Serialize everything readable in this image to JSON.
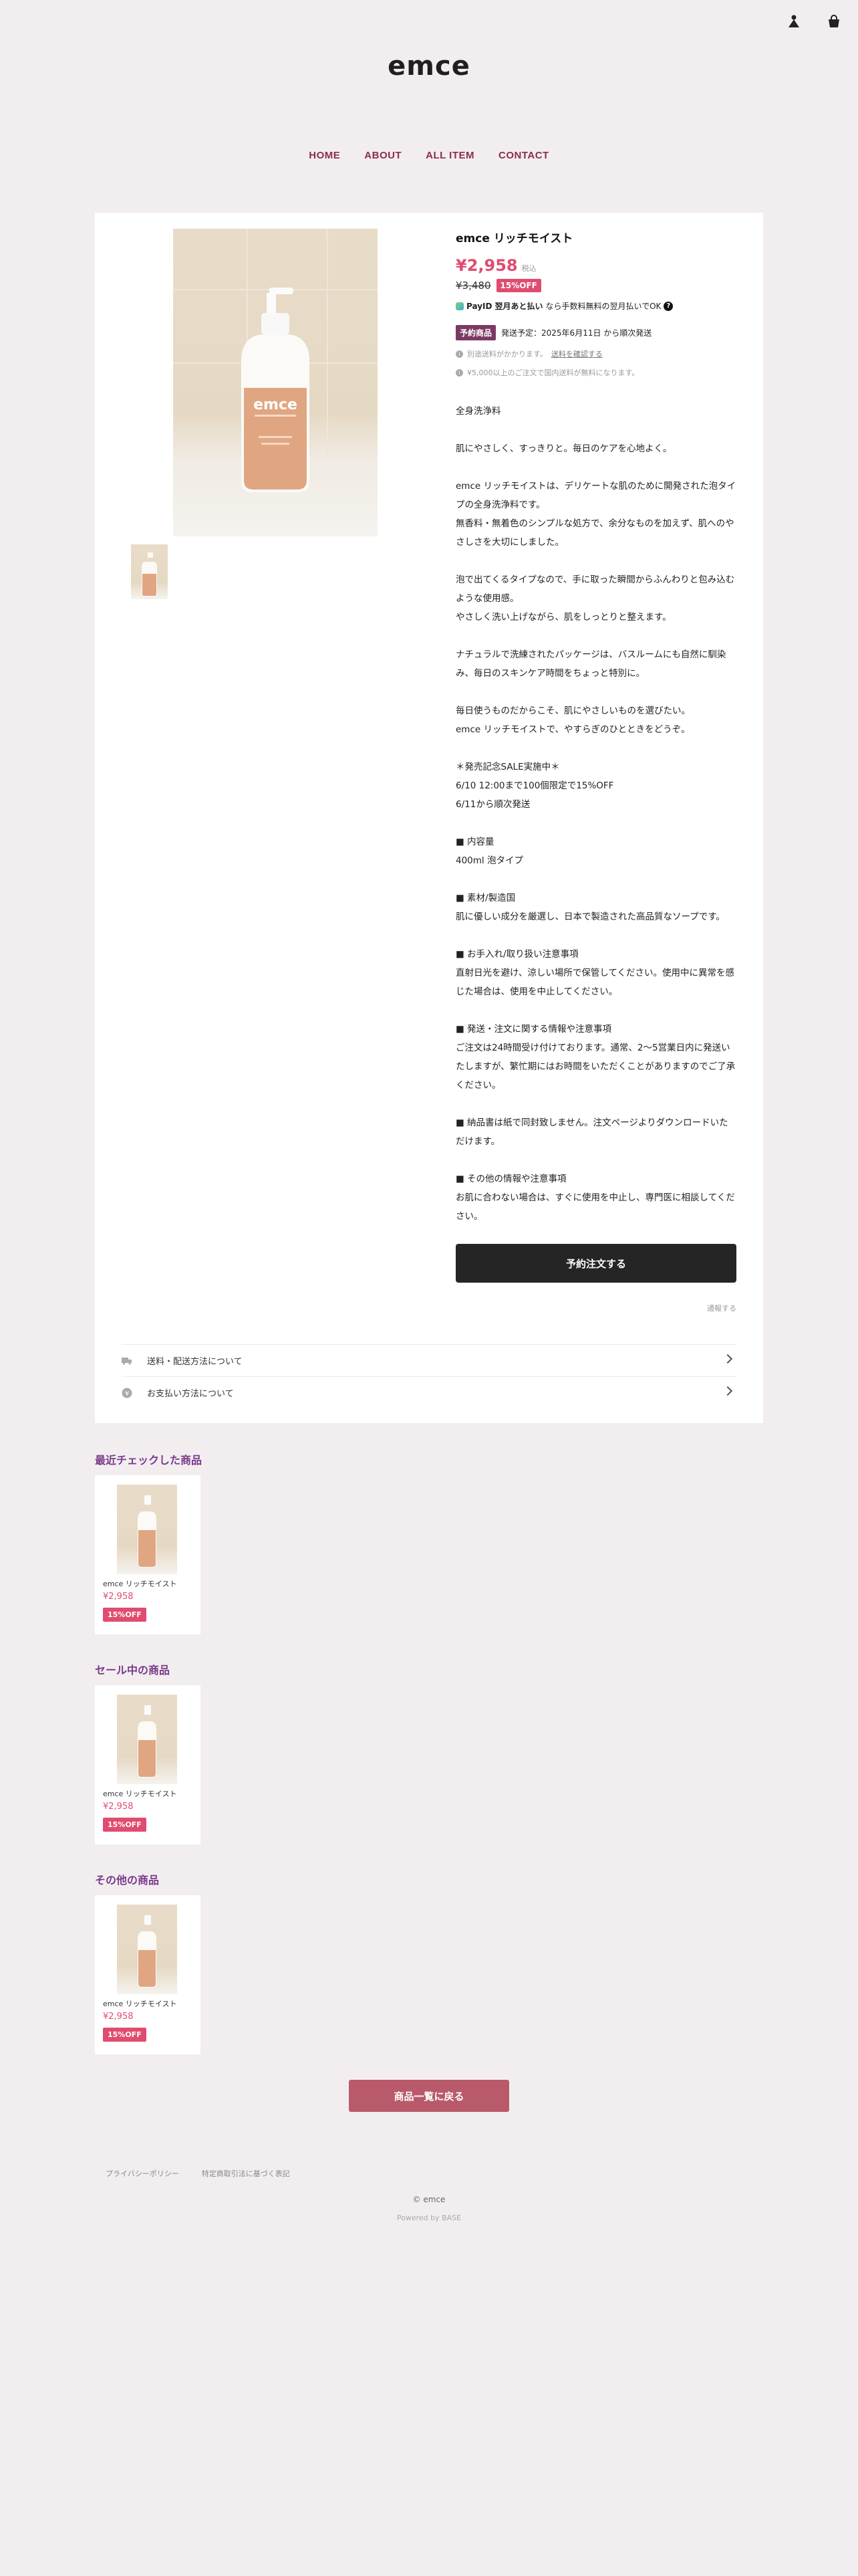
{
  "header": {
    "logo": "emce",
    "nav": [
      "HOME",
      "ABOUT",
      "ALL ITEM",
      "CONTACT"
    ]
  },
  "product": {
    "image_brand": "emce",
    "title": "emce リッチモイスト",
    "price": "¥2,958",
    "tax_label": "税込",
    "old_price": "¥3,480",
    "off_badge": "15%OFF",
    "payid_text_bold": "翌月あと払い",
    "payid_text": "なら手数料無料の翌月払いでOK",
    "payid_brand": "PayID",
    "preorder_badge": "予約商品",
    "preorder_text": "発送予定：2025年6月11日 から順次発送",
    "shipping_note_prefix": "別途送料がかかります。",
    "shipping_note_link": "送料を確認する",
    "free_shipping_note": "¥5,000以上のご注文で国内送料が無料になります。",
    "description": "全身洗浄料\n\n肌にやさしく、すっきりと。毎日のケアを心地よく。\n\nemce リッチモイストは、デリケートな肌のために開発された泡タイプの全身洗浄料です。\n無香料・無着色のシンプルな処方で、余分なものを加えず、肌へのやさしさを大切にしました。\n\n泡で出てくるタイプなので、手に取った瞬間からふんわりと包み込むような使用感。\nやさしく洗い上げながら、肌をしっとりと整えます。\n\nナチュラルで洗練されたパッケージは、バスルームにも自然に馴染み、毎日のスキンケア時間をちょっと特別に。\n\n毎日使うものだからこそ、肌にやさしいものを選びたい。\nemce リッチモイストで、やすらぎのひとときをどうぞ。\n\n＊発売記念SALE実施中＊\n6/10 12:00まで100個限定で15%OFF\n6/11から順次発送\n\n■ 内容量\n400ml 泡タイプ\n\n■ 素材/製造国\n肌に優しい成分を厳選し、日本で製造された高品質なソープです。\n\n■ お手入れ/取り扱い注意事項\n直射日光を避け、涼しい場所で保管してください。使用中に異常を感じた場合は、使用を中止してください。\n\n■ 発送・注文に関する情報や注意事項\nご注文は24時間受け付けております。通常、2〜5営業日内に発送いたしますが、繁忙期にはお時間をいただくことがありますのでご了承ください。\n\n■ 納品書は紙で同封致しません。注文ページよりダウンロードいただけます。\n\n■ その他の情報や注意事項\nお肌に合わない場合は、すぐに使用を中止し、専門医に相談してください。",
    "order_button": "予約注文する",
    "contact_link": "通報する",
    "accordion": [
      "送料・配送方法について",
      "お支払い方法について"
    ]
  },
  "sections": [
    {
      "title": "最近チェックした商品",
      "item": {
        "name": "emce リッチモイスト",
        "price": "¥2,958",
        "badge": "15%OFF"
      }
    },
    {
      "title": "セール中の商品",
      "item": {
        "name": "emce リッチモイスト",
        "price": "¥2,958",
        "badge": "15%OFF"
      }
    },
    {
      "title": "その他の商品",
      "item": {
        "name": "emce リッチモイスト",
        "price": "¥2,958",
        "badge": "15%OFF"
      }
    }
  ],
  "back_button": "商品一覧に戻る",
  "footer": {
    "links": [
      "プライバシーポリシー",
      "特定商取引法に基づく表記"
    ],
    "copyright": "© emce",
    "powered": "Powered by BASE"
  },
  "colors": {
    "background": "#f2eef0",
    "nav": "#8a2e4a",
    "price": "#e04c6f",
    "section_title": "#7a3a8a",
    "order_button": "#252525",
    "back_button": "#b95a6a"
  }
}
